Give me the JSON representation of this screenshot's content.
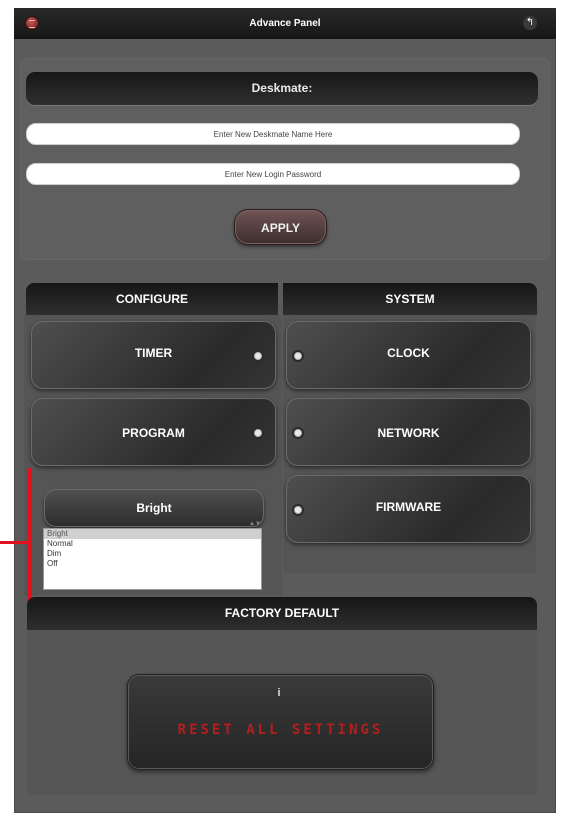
{
  "header": {
    "title": "Advance Panel",
    "menu_icon": "menu-icon",
    "back_icon": "back-icon",
    "back_glyph": "↰"
  },
  "deskmate": {
    "title": "Deskmate:",
    "name_placeholder": "Enter New Deskmate Name Here",
    "password_placeholder": "Enter New Login Password",
    "apply_label": "APPLY"
  },
  "configure": {
    "header": "CONFIGURE",
    "timer_label": "TIMER",
    "program_label": "PROGRAM",
    "brightness": {
      "selected": "Bright",
      "options": [
        "Bright",
        "Normal",
        "Dim",
        "Off"
      ]
    }
  },
  "system": {
    "header": "SYSTEM",
    "clock_label": "CLOCK",
    "network_label": "NETWORK",
    "firmware_label": "FIRMWARE"
  },
  "factory": {
    "header": "FACTORY DEFAULT",
    "info_icon": "info-icon",
    "info_glyph": "i",
    "reset_label": "RESET ALL SETTINGS"
  },
  "colors": {
    "panel_background": "#5b5b5b",
    "apply_button": "#5a4444",
    "reset_text": "#b51e1e",
    "annotation": "#e3101e"
  }
}
